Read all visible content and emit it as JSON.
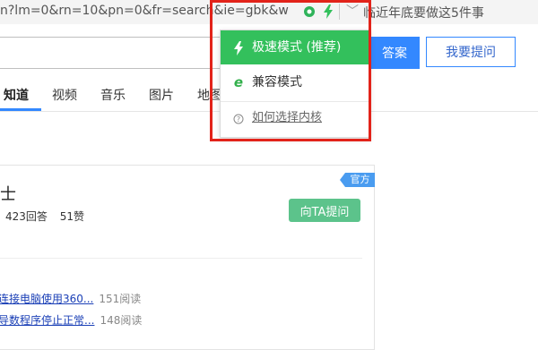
{
  "urlbar": {
    "url_text": "n?lm=0&rn=10&pn=0&fr=search&ie=gbk&w",
    "tail_text": "临近年底要做这5件事",
    "chevron": "﹀"
  },
  "search": {
    "answer_button": "答案",
    "ask_button": "我要提问"
  },
  "nav": {
    "items": [
      "知道",
      "视频",
      "音乐",
      "图片",
      "地图"
    ]
  },
  "card": {
    "badge": "官方",
    "title": "士",
    "stats": {
      "answers": "423回答",
      "likes": "51赞"
    },
    "ask_ta_button": "向TA提问",
    "questions": [
      {
        "title": "连接电脑使用360...",
        "reads": "151阅读"
      },
      {
        "title": "导数程序停止正常...",
        "reads": "148阅读"
      }
    ]
  },
  "popup": {
    "items": [
      {
        "label": "极速模式 (推荐)",
        "icon": "lightning-icon"
      },
      {
        "label": "兼容模式",
        "icon": "ie-icon"
      },
      {
        "label": "如何选择内核",
        "icon": "help-icon"
      }
    ]
  },
  "colors": {
    "accent_blue": "#3388ff",
    "fast_green": "#33c05c",
    "ta_green": "#5cc38b",
    "highlight_red": "#e2231a",
    "badge_blue": "#4a9cf0"
  }
}
